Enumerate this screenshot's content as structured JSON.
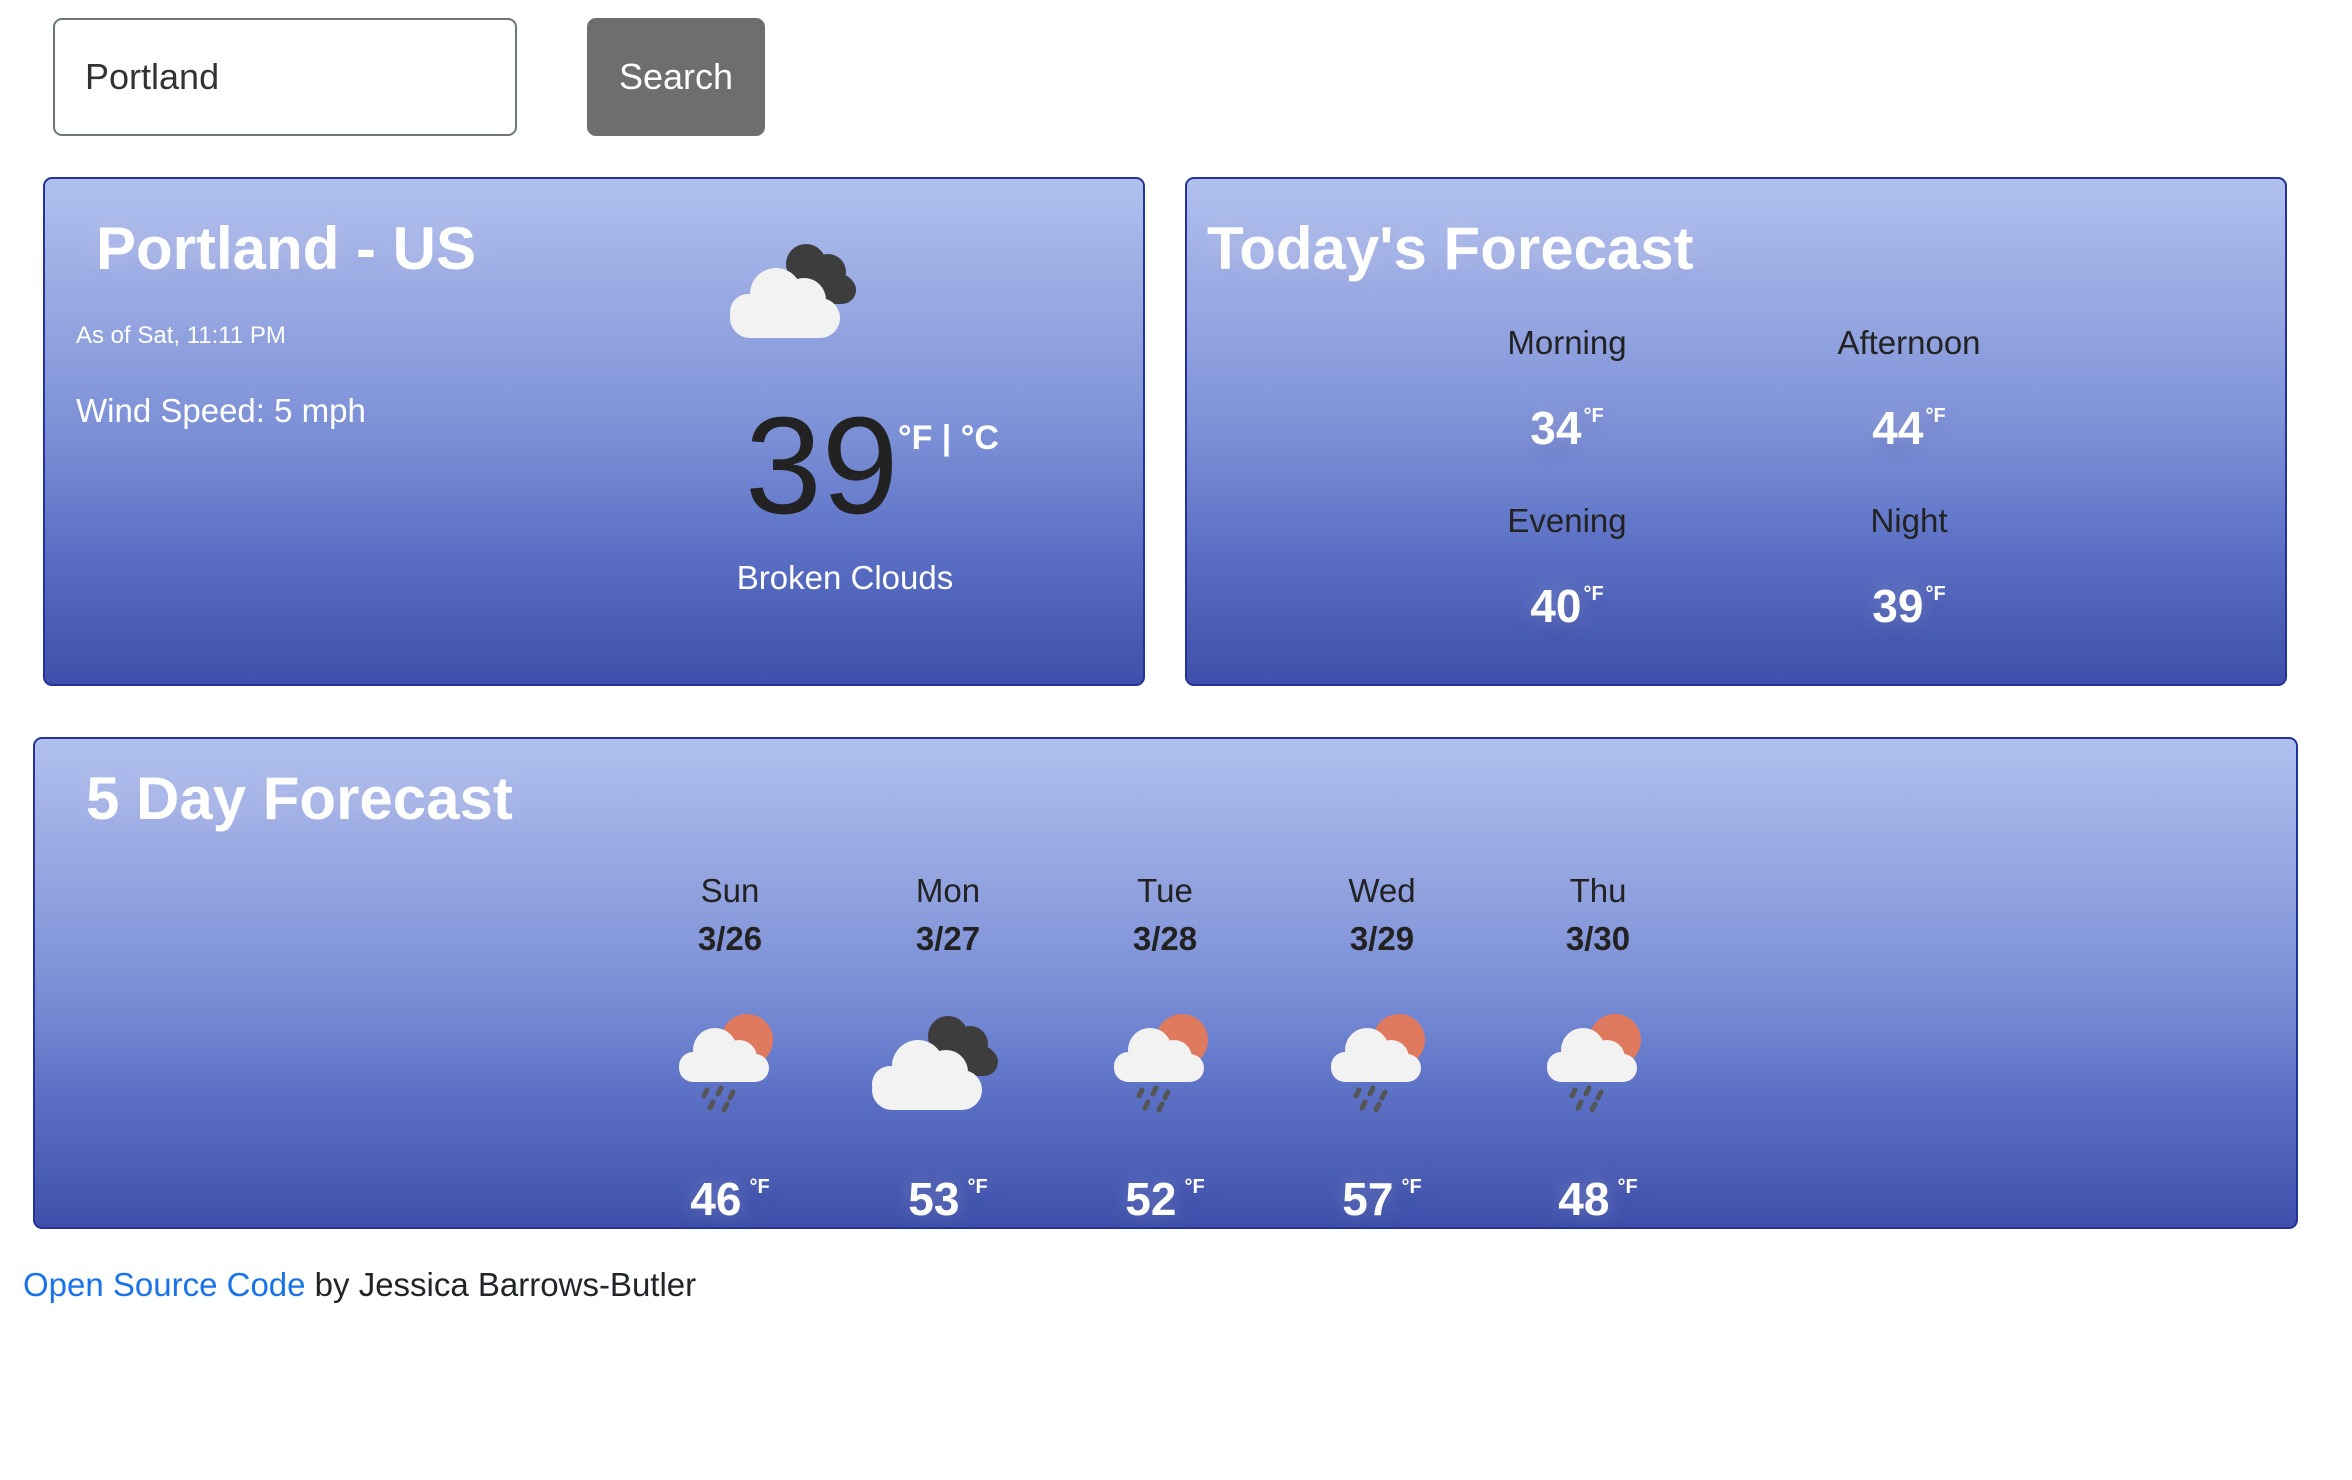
{
  "search": {
    "value": "Portland",
    "button_label": "Search"
  },
  "current": {
    "location": "Portland - US",
    "as_of": "As of Sat, 11:11 PM",
    "wind": "Wind Speed: 5 mph",
    "temperature": "39",
    "units": "°F | °C",
    "condition": "Broken Clouds",
    "icon": "broken-clouds-icon"
  },
  "today": {
    "title": "Today's Forecast",
    "periods": [
      {
        "name": "Morning",
        "temp": "34",
        "unit": "°F"
      },
      {
        "name": "Afternoon",
        "temp": "44",
        "unit": "°F"
      },
      {
        "name": "Evening",
        "temp": "40",
        "unit": "°F"
      },
      {
        "name": "Night",
        "temp": "39",
        "unit": "°F"
      }
    ]
  },
  "fiveday": {
    "title": "5 Day Forecast",
    "days": [
      {
        "name": "Sun",
        "date": "3/26",
        "temp": "46",
        "unit": "°F",
        "icon": "sun-rain-icon"
      },
      {
        "name": "Mon",
        "date": "3/27",
        "temp": "53",
        "unit": "°F",
        "icon": "broken-clouds-icon"
      },
      {
        "name": "Tue",
        "date": "3/28",
        "temp": "52",
        "unit": "°F",
        "icon": "sun-rain-icon"
      },
      {
        "name": "Wed",
        "date": "3/29",
        "temp": "57",
        "unit": "°F",
        "icon": "sun-rain-icon"
      },
      {
        "name": "Thu",
        "date": "3/30",
        "temp": "48",
        "unit": "°F",
        "icon": "sun-rain-icon"
      }
    ]
  },
  "footer": {
    "link_text": "Open Source Code",
    "byline": " by Jessica Barrows-Butler"
  },
  "colors": {
    "card_top": "#b0c0ef",
    "card_bottom": "#3e50ab",
    "link": "#1a73e8",
    "button": "#6e6e6e"
  }
}
